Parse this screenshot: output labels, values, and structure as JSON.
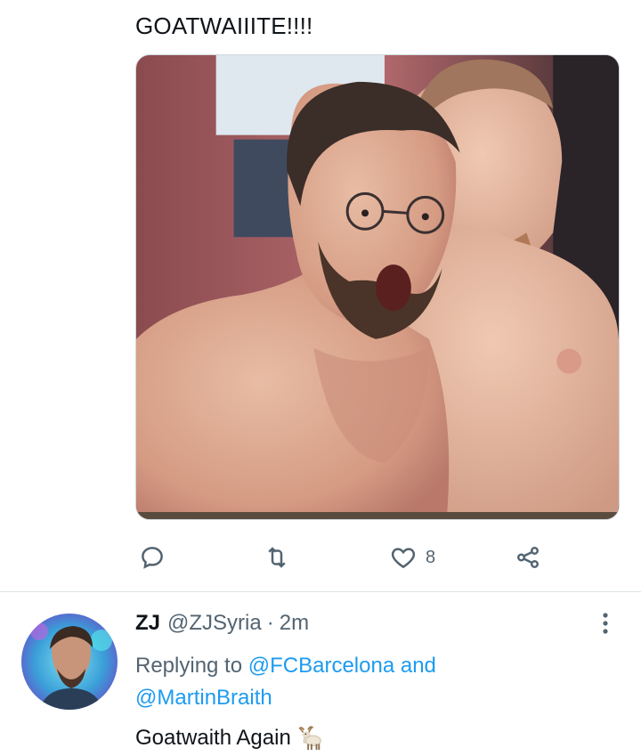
{
  "tweet": {
    "text": "GOATWAIIITE!!!!",
    "likes": "8"
  },
  "icons": {
    "reply": "comment-icon",
    "retweet": "retweet-icon",
    "like": "heart-icon",
    "share": "share-icon",
    "more": "more-vertical-icon"
  },
  "reply": {
    "name": "ZJ",
    "handle": "@ZJSyria",
    "separator": "·",
    "time": "2m",
    "replying_prefix": "Replying to",
    "mention1": "@FCBarcelona",
    "conjunction": "and",
    "mention2": "@MartinBraith",
    "text": "Goatwaith Again"
  },
  "colors": {
    "link": "#1d9bf0",
    "secondary_text": "#536471",
    "primary_text": "#0f1419"
  }
}
